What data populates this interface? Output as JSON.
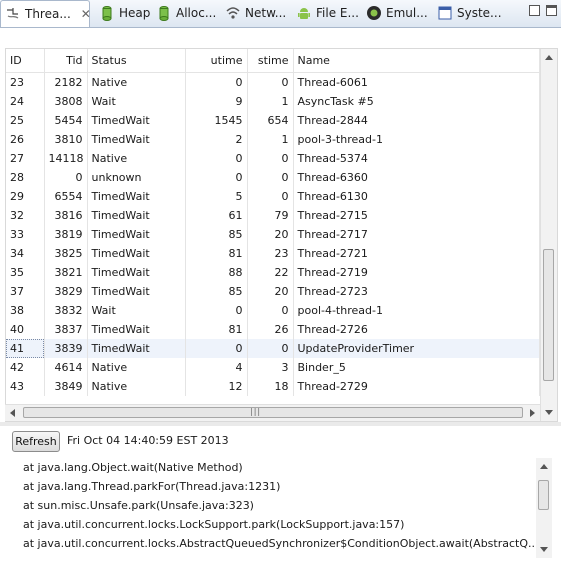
{
  "tabs": [
    {
      "label": "Threa...",
      "icon": "threads-icon",
      "active": true
    },
    {
      "label": "Heap",
      "icon": "heap-icon",
      "active": false
    },
    {
      "label": "Alloc...",
      "icon": "allocation-icon",
      "active": false
    },
    {
      "label": "Netw...",
      "icon": "network-icon",
      "active": false
    },
    {
      "label": "File E...",
      "icon": "android-icon",
      "active": false
    },
    {
      "label": "Emul...",
      "icon": "emulator-icon",
      "active": false
    },
    {
      "label": "Syste...",
      "icon": "system-icon",
      "active": false
    }
  ],
  "table": {
    "columns": [
      "ID",
      "Tid",
      "Status",
      "utime",
      "stime",
      "Name"
    ],
    "rows": [
      [
        "23",
        "2182",
        "Native",
        "0",
        "0",
        "Thread-6061"
      ],
      [
        "24",
        "3808",
        "Wait",
        "9",
        "1",
        "AsyncTask #5"
      ],
      [
        "25",
        "5454",
        "TimedWait",
        "1545",
        "654",
        "Thread-2844"
      ],
      [
        "26",
        "3810",
        "TimedWait",
        "2",
        "1",
        "pool-3-thread-1"
      ],
      [
        "27",
        "14118",
        "Native",
        "0",
        "0",
        "Thread-5374"
      ],
      [
        "28",
        "0",
        "unknown",
        "0",
        "0",
        "Thread-6360"
      ],
      [
        "29",
        "6554",
        "TimedWait",
        "5",
        "0",
        "Thread-6130"
      ],
      [
        "32",
        "3816",
        "TimedWait",
        "61",
        "79",
        "Thread-2715"
      ],
      [
        "33",
        "3819",
        "TimedWait",
        "85",
        "20",
        "Thread-2717"
      ],
      [
        "34",
        "3825",
        "TimedWait",
        "81",
        "23",
        "Thread-2721"
      ],
      [
        "35",
        "3821",
        "TimedWait",
        "88",
        "22",
        "Thread-2719"
      ],
      [
        "37",
        "3829",
        "TimedWait",
        "85",
        "20",
        "Thread-2723"
      ],
      [
        "38",
        "3832",
        "Wait",
        "0",
        "0",
        "pool-4-thread-1"
      ],
      [
        "40",
        "3837",
        "TimedWait",
        "81",
        "26",
        "Thread-2726"
      ],
      [
        "41",
        "3839",
        "TimedWait",
        "0",
        "0",
        "UpdateProviderTimer"
      ],
      [
        "42",
        "4614",
        "Native",
        "4",
        "3",
        "Binder_5"
      ],
      [
        "43",
        "3849",
        "Native",
        "12",
        "18",
        "Thread-2729"
      ]
    ],
    "selected_index": 14
  },
  "refresh_label": "Refresh",
  "timestamp": "Fri Oct 04 14:40:59 EST 2013",
  "stack_trace": [
    "at java.lang.Object.wait(Native Method)",
    "at java.lang.Thread.parkFor(Thread.java:1231)",
    "at sun.misc.Unsafe.park(Unsafe.java:323)",
    "at java.util.concurrent.locks.LockSupport.park(LockSupport.java:157)",
    "at java.util.concurrent.locks.AbstractQueuedSynchronizer$ConditionObject.await(AbstractQ..."
  ],
  "colors": {
    "selection": "#eef3fb",
    "tab_border": "#a9b8cc"
  }
}
